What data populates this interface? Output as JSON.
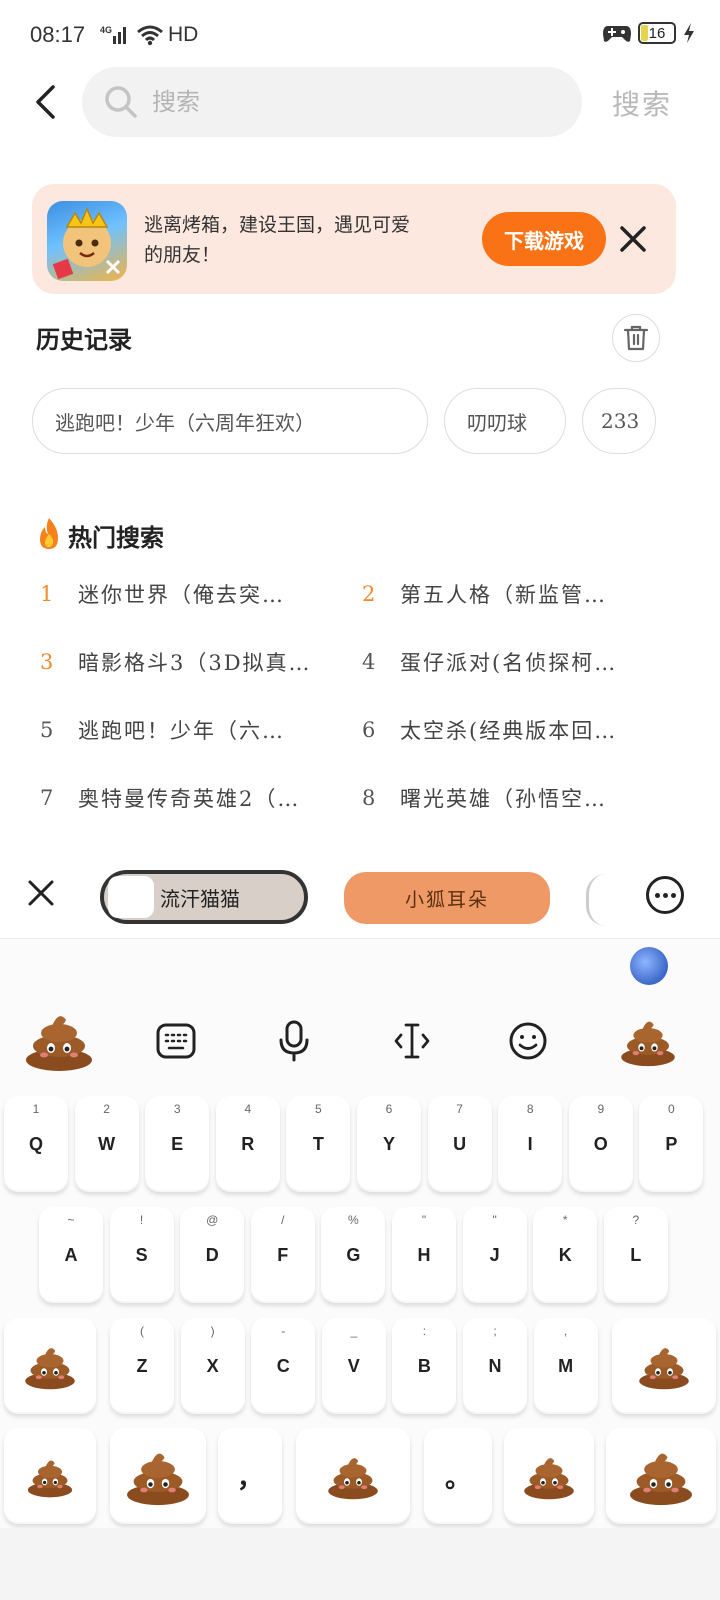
{
  "status_bar": {
    "time": "08:17",
    "network": "4G",
    "signal_label": "HD",
    "battery": "16"
  },
  "header": {
    "search_placeholder": "搜索",
    "search_button": "搜索"
  },
  "ad": {
    "text": "逃离烤箱，建设王国，遇见可爱的朋友！",
    "download_button": "下载游戏"
  },
  "history": {
    "title": "历史记录",
    "items": [
      "逃跑吧！少年（六周年狂欢）",
      "叨叨球",
      "233"
    ]
  },
  "hot": {
    "title": "热门搜索",
    "items": [
      {
        "rank": "1",
        "text": "迷你世界（俺去突…"
      },
      {
        "rank": "2",
        "text": "第五人格（新监管…"
      },
      {
        "rank": "3",
        "text": "暗影格斗3（3D拟真…"
      },
      {
        "rank": "4",
        "text": "蛋仔派对(名侦探柯…"
      },
      {
        "rank": "5",
        "text": "逃跑吧！少年（六…"
      },
      {
        "rank": "6",
        "text": "太空杀(经典版本回…"
      },
      {
        "rank": "7",
        "text": "奥特曼传奇英雄2（…"
      },
      {
        "rank": "8",
        "text": "曙光英雄（孙悟空…"
      }
    ]
  },
  "stickers": {
    "items": [
      "流汗猫猫",
      "小狐耳朵"
    ]
  },
  "keyboard": {
    "row1": [
      {
        "main": "Q",
        "sub": "1"
      },
      {
        "main": "W",
        "sub": "2"
      },
      {
        "main": "E",
        "sub": "3"
      },
      {
        "main": "R",
        "sub": "4"
      },
      {
        "main": "T",
        "sub": "5"
      },
      {
        "main": "Y",
        "sub": "6"
      },
      {
        "main": "U",
        "sub": "7"
      },
      {
        "main": "I",
        "sub": "8"
      },
      {
        "main": "O",
        "sub": "9"
      },
      {
        "main": "P",
        "sub": "0"
      }
    ],
    "row2": [
      {
        "main": "A",
        "sub": "~"
      },
      {
        "main": "S",
        "sub": "!"
      },
      {
        "main": "D",
        "sub": "@"
      },
      {
        "main": "F",
        "sub": "/"
      },
      {
        "main": "G",
        "sub": "%"
      },
      {
        "main": "H",
        "sub": "\""
      },
      {
        "main": "J",
        "sub": "\""
      },
      {
        "main": "K",
        "sub": "*"
      },
      {
        "main": "L",
        "sub": "?"
      }
    ],
    "row3": [
      {
        "main": "Z",
        "sub": "("
      },
      {
        "main": "X",
        "sub": ")"
      },
      {
        "main": "C",
        "sub": "-"
      },
      {
        "main": "V",
        "sub": "_"
      },
      {
        "main": "B",
        "sub": ":"
      },
      {
        "main": "N",
        "sub": ";"
      },
      {
        "main": "M",
        "sub": ","
      }
    ],
    "row4": {
      "comma": "，",
      "period": "。"
    }
  }
}
